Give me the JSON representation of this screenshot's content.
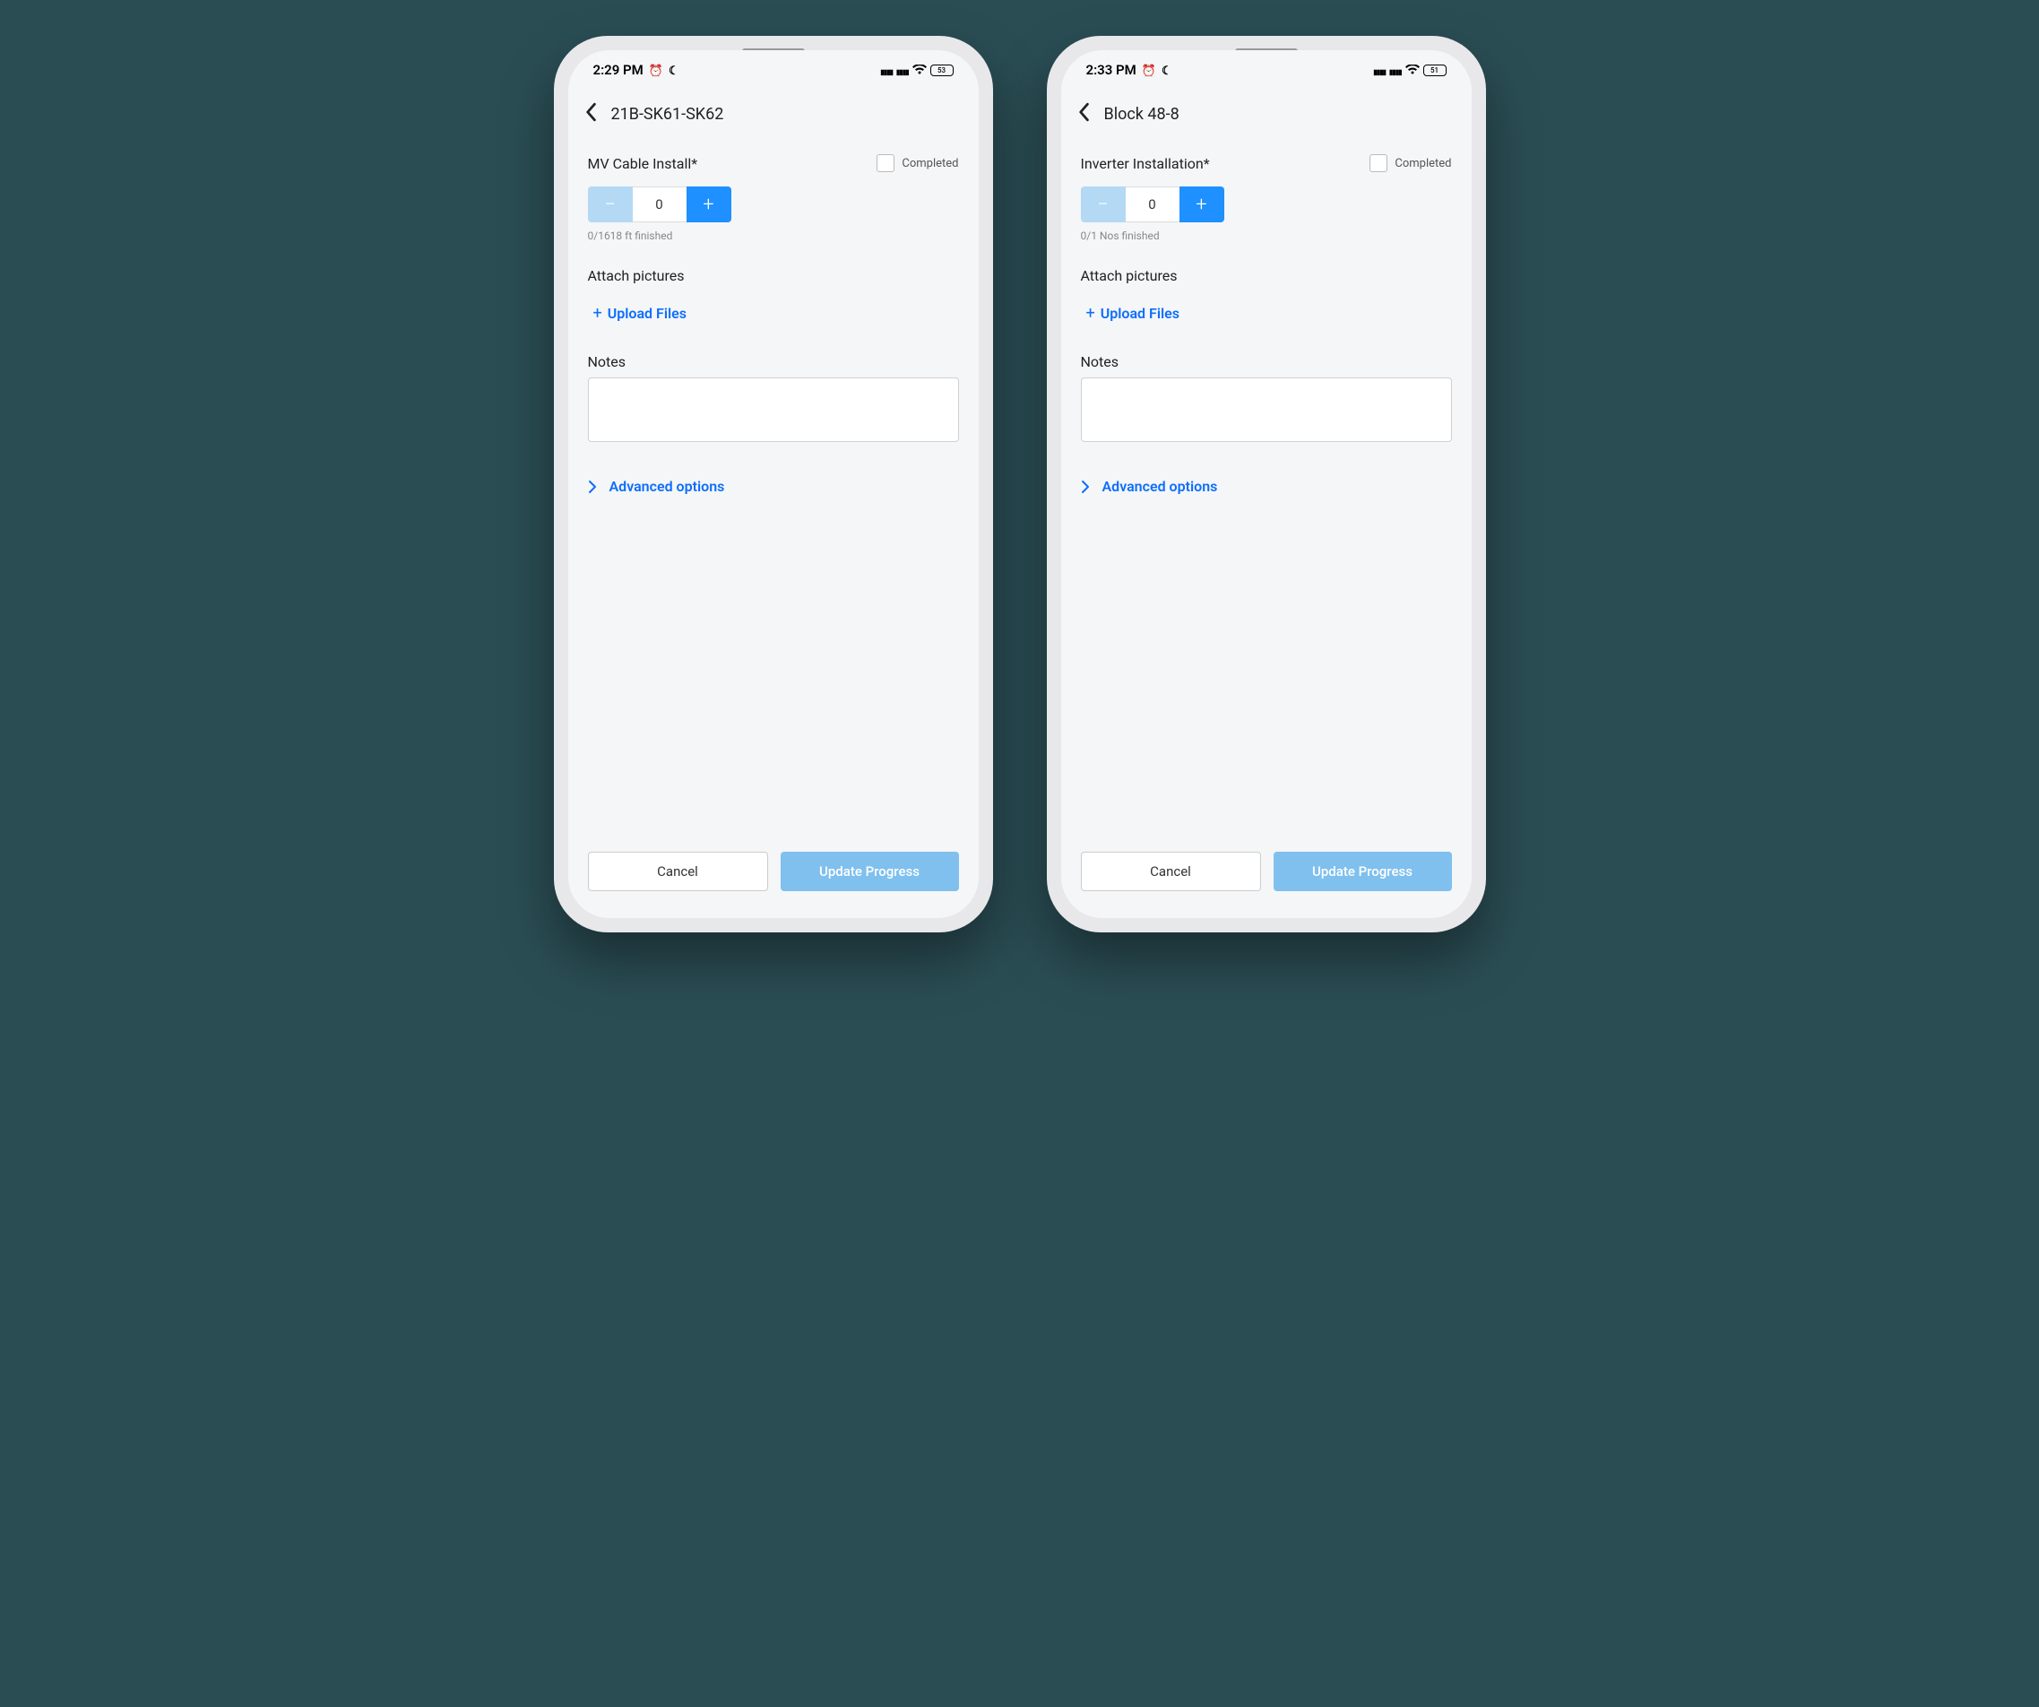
{
  "phones": [
    {
      "status": {
        "time": "2:29 PM",
        "battery": "53"
      },
      "header": {
        "title": "21B-SK61-SK62"
      },
      "task": {
        "label": "MV Cable Install*",
        "completed_label": "Completed",
        "stepper_value": "0",
        "stepper_sub": "0/1618 ft finished"
      },
      "attach_label": "Attach pictures",
      "upload_label": "Upload Files",
      "notes_label": "Notes",
      "advanced_label": "Advanced options",
      "buttons": {
        "cancel": "Cancel",
        "update": "Update Progress"
      }
    },
    {
      "status": {
        "time": "2:33 PM",
        "battery": "51"
      },
      "header": {
        "title": "Block 48-8"
      },
      "task": {
        "label": "Inverter Installation*",
        "completed_label": "Completed",
        "stepper_value": "0",
        "stepper_sub": "0/1 Nos finished"
      },
      "attach_label": "Attach pictures",
      "upload_label": "Upload Files",
      "notes_label": "Notes",
      "advanced_label": "Advanced options",
      "buttons": {
        "cancel": "Cancel",
        "update": "Update Progress"
      }
    }
  ]
}
